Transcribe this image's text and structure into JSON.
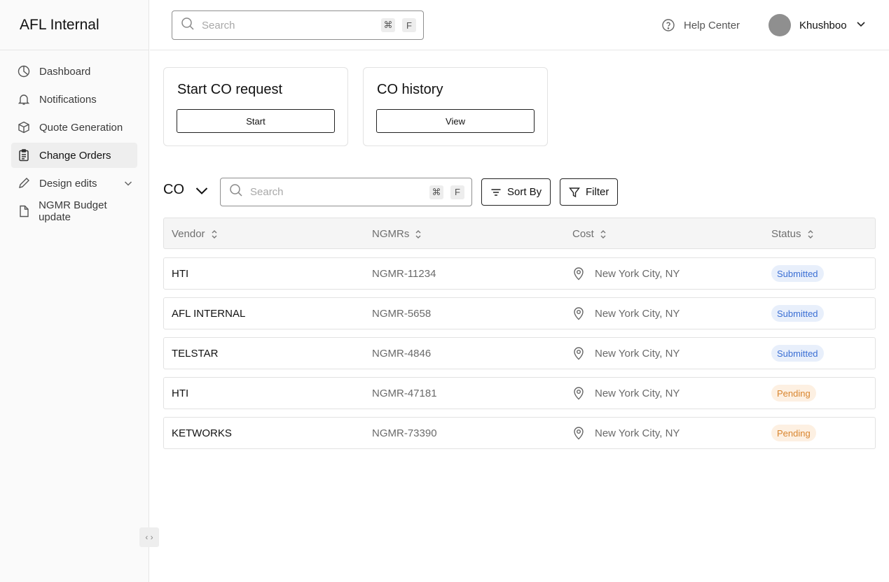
{
  "app": {
    "title": "AFL Internal"
  },
  "sidebar": {
    "items": [
      {
        "label": "Dashboard",
        "icon": "dashboard-icon"
      },
      {
        "label": "Notifications",
        "icon": "bell-icon"
      },
      {
        "label": "Quote Generation",
        "icon": "cube-icon"
      },
      {
        "label": "Change Orders",
        "icon": "clipboard-icon",
        "active": true
      },
      {
        "label": "Design edits",
        "icon": "pencil-icon",
        "expandable": true
      },
      {
        "label": "NGMR Budget update",
        "icon": "file-icon"
      }
    ],
    "collapse_handle": "‹ ›"
  },
  "header": {
    "search_placeholder": "Search",
    "shortcut_cmd": "⌘",
    "shortcut_key": "F",
    "help_label": "Help Center",
    "user_name": "Khushboo"
  },
  "cards": [
    {
      "title": "Start CO request",
      "button": "Start"
    },
    {
      "title": "CO history",
      "button": "View"
    }
  ],
  "toolbar": {
    "selector_label": "CO",
    "search_placeholder": "Search",
    "shortcut_cmd": "⌘",
    "shortcut_key": "F",
    "sort_label": "Sort By",
    "filter_label": "Filter"
  },
  "table": {
    "headers": [
      "Vendor",
      "NGMRs",
      "Cost",
      "Status"
    ],
    "rows": [
      {
        "vendor": "HTI",
        "ngmr": "NGMR-11234",
        "cost": "New York City, NY",
        "status": "Submitted"
      },
      {
        "vendor": "AFL INTERNAL",
        "ngmr": "NGMR-5658",
        "cost": "New York City, NY",
        "status": "Submitted"
      },
      {
        "vendor": "TELSTAR",
        "ngmr": "NGMR-4846",
        "cost": "New York City, NY",
        "status": "Submitted"
      },
      {
        "vendor": "HTI",
        "ngmr": "NGMR-47181",
        "cost": "New York City, NY",
        "status": "Pending"
      },
      {
        "vendor": "KETWORKS",
        "ngmr": "NGMR-73390",
        "cost": "New York City, NY",
        "status": "Pending"
      }
    ]
  },
  "colors": {
    "submitted_bg": "#e8effb",
    "submitted_text": "#3b6fd4",
    "pending_bg": "#fdf0e2",
    "pending_text": "#d9852e"
  }
}
